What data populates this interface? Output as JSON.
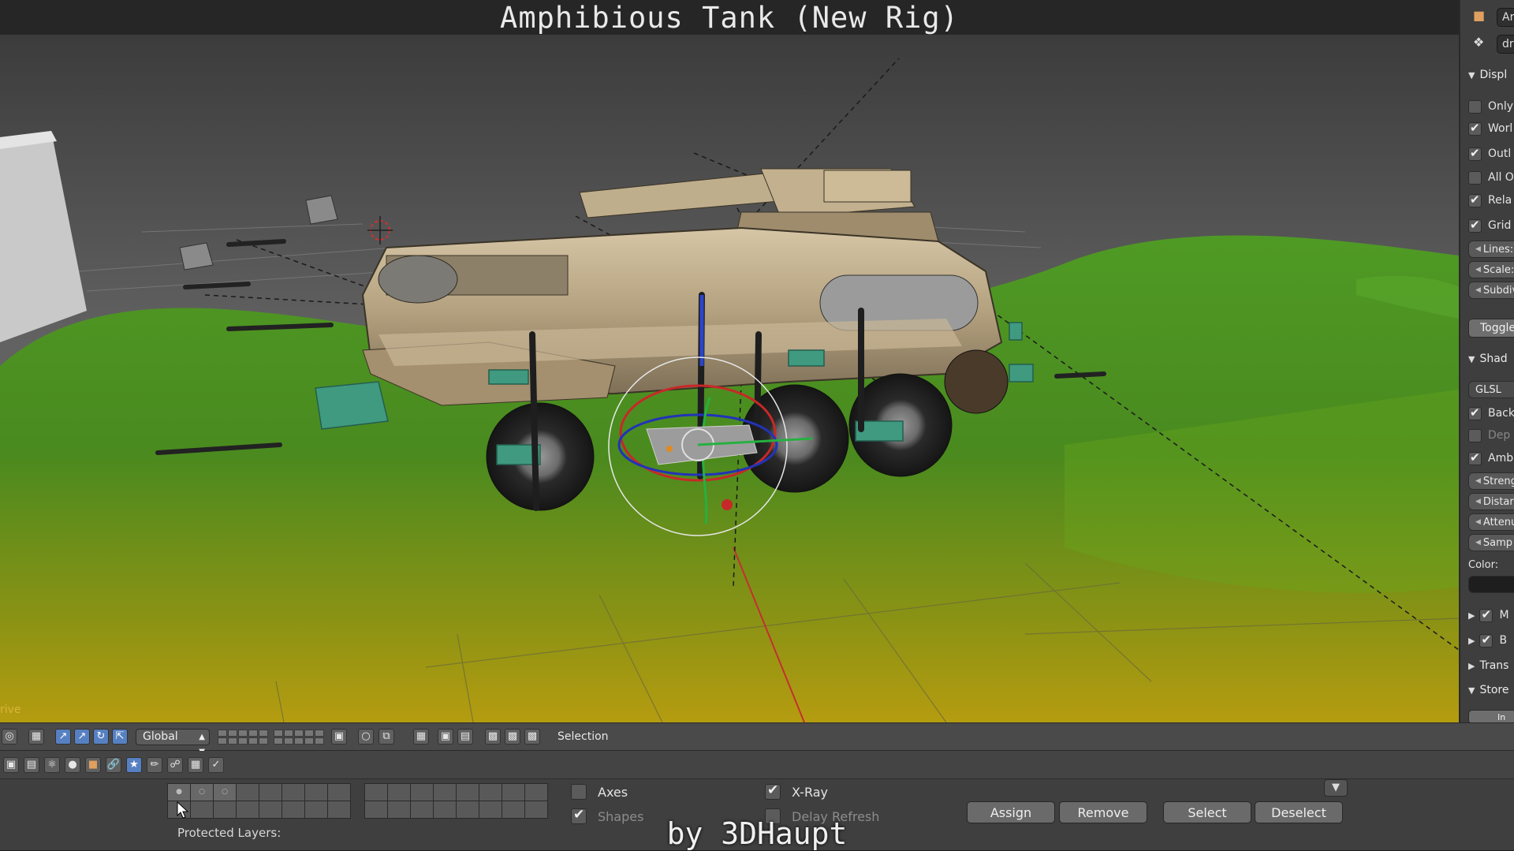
{
  "title": "Amphibious Tank (New Rig)",
  "credit": "by 3DHaupt",
  "viewport": {
    "frame_label": "rive"
  },
  "props": {
    "top_field_1": "Ar",
    "top_field_2": "dr",
    "display_header": "Displ",
    "display_items": [
      {
        "label": "Only",
        "checked": false
      },
      {
        "label": "Worl",
        "checked": true
      },
      {
        "label": "Outl",
        "checked": true
      },
      {
        "label": "All O",
        "checked": false
      },
      {
        "label": "Rela",
        "checked": true
      },
      {
        "label": "Grid",
        "checked": true
      }
    ],
    "grid_fields": [
      "Lines:",
      "Scale:",
      "Subdiv"
    ],
    "toggle_label": "Toggle",
    "shading_header": "Shad",
    "shading_mode": "GLSL",
    "shading_items": [
      {
        "label": "Back",
        "checked": true
      },
      {
        "label": "Dep",
        "checked": false
      },
      {
        "label": "Amb",
        "checked": true
      }
    ],
    "ao_fields": [
      "Streng",
      "Distar",
      "Attenu",
      "Samp"
    ],
    "color_label": "Color:",
    "collapsed_panels": [
      {
        "label": "M",
        "checked": true
      },
      {
        "label": "B",
        "checked": true
      }
    ],
    "transform_header": "Trans",
    "stored_header": "Store",
    "stored_button": "In"
  },
  "header": {
    "orientation": "Global",
    "selection_label": "Selection"
  },
  "bottom": {
    "axes_label": "Axes",
    "axes_checked": false,
    "shapes_label": "Shapes",
    "shapes_checked": true,
    "xray_label": "X-Ray",
    "xray_checked": true,
    "delay_refresh_label": "Delay Refresh",
    "delay_refresh_checked": false,
    "protected_layers_label": "Protected Layers:",
    "assign_label": "Assign",
    "remove_label": "Remove",
    "select_label": "Select",
    "deselect_label": "Deselect"
  },
  "colors": {
    "terrain_green": "#4a8a1f",
    "terrain_yellow": "#b09a12",
    "bone_teal": "#3f9a80",
    "tank_body": "#b8a584"
  }
}
